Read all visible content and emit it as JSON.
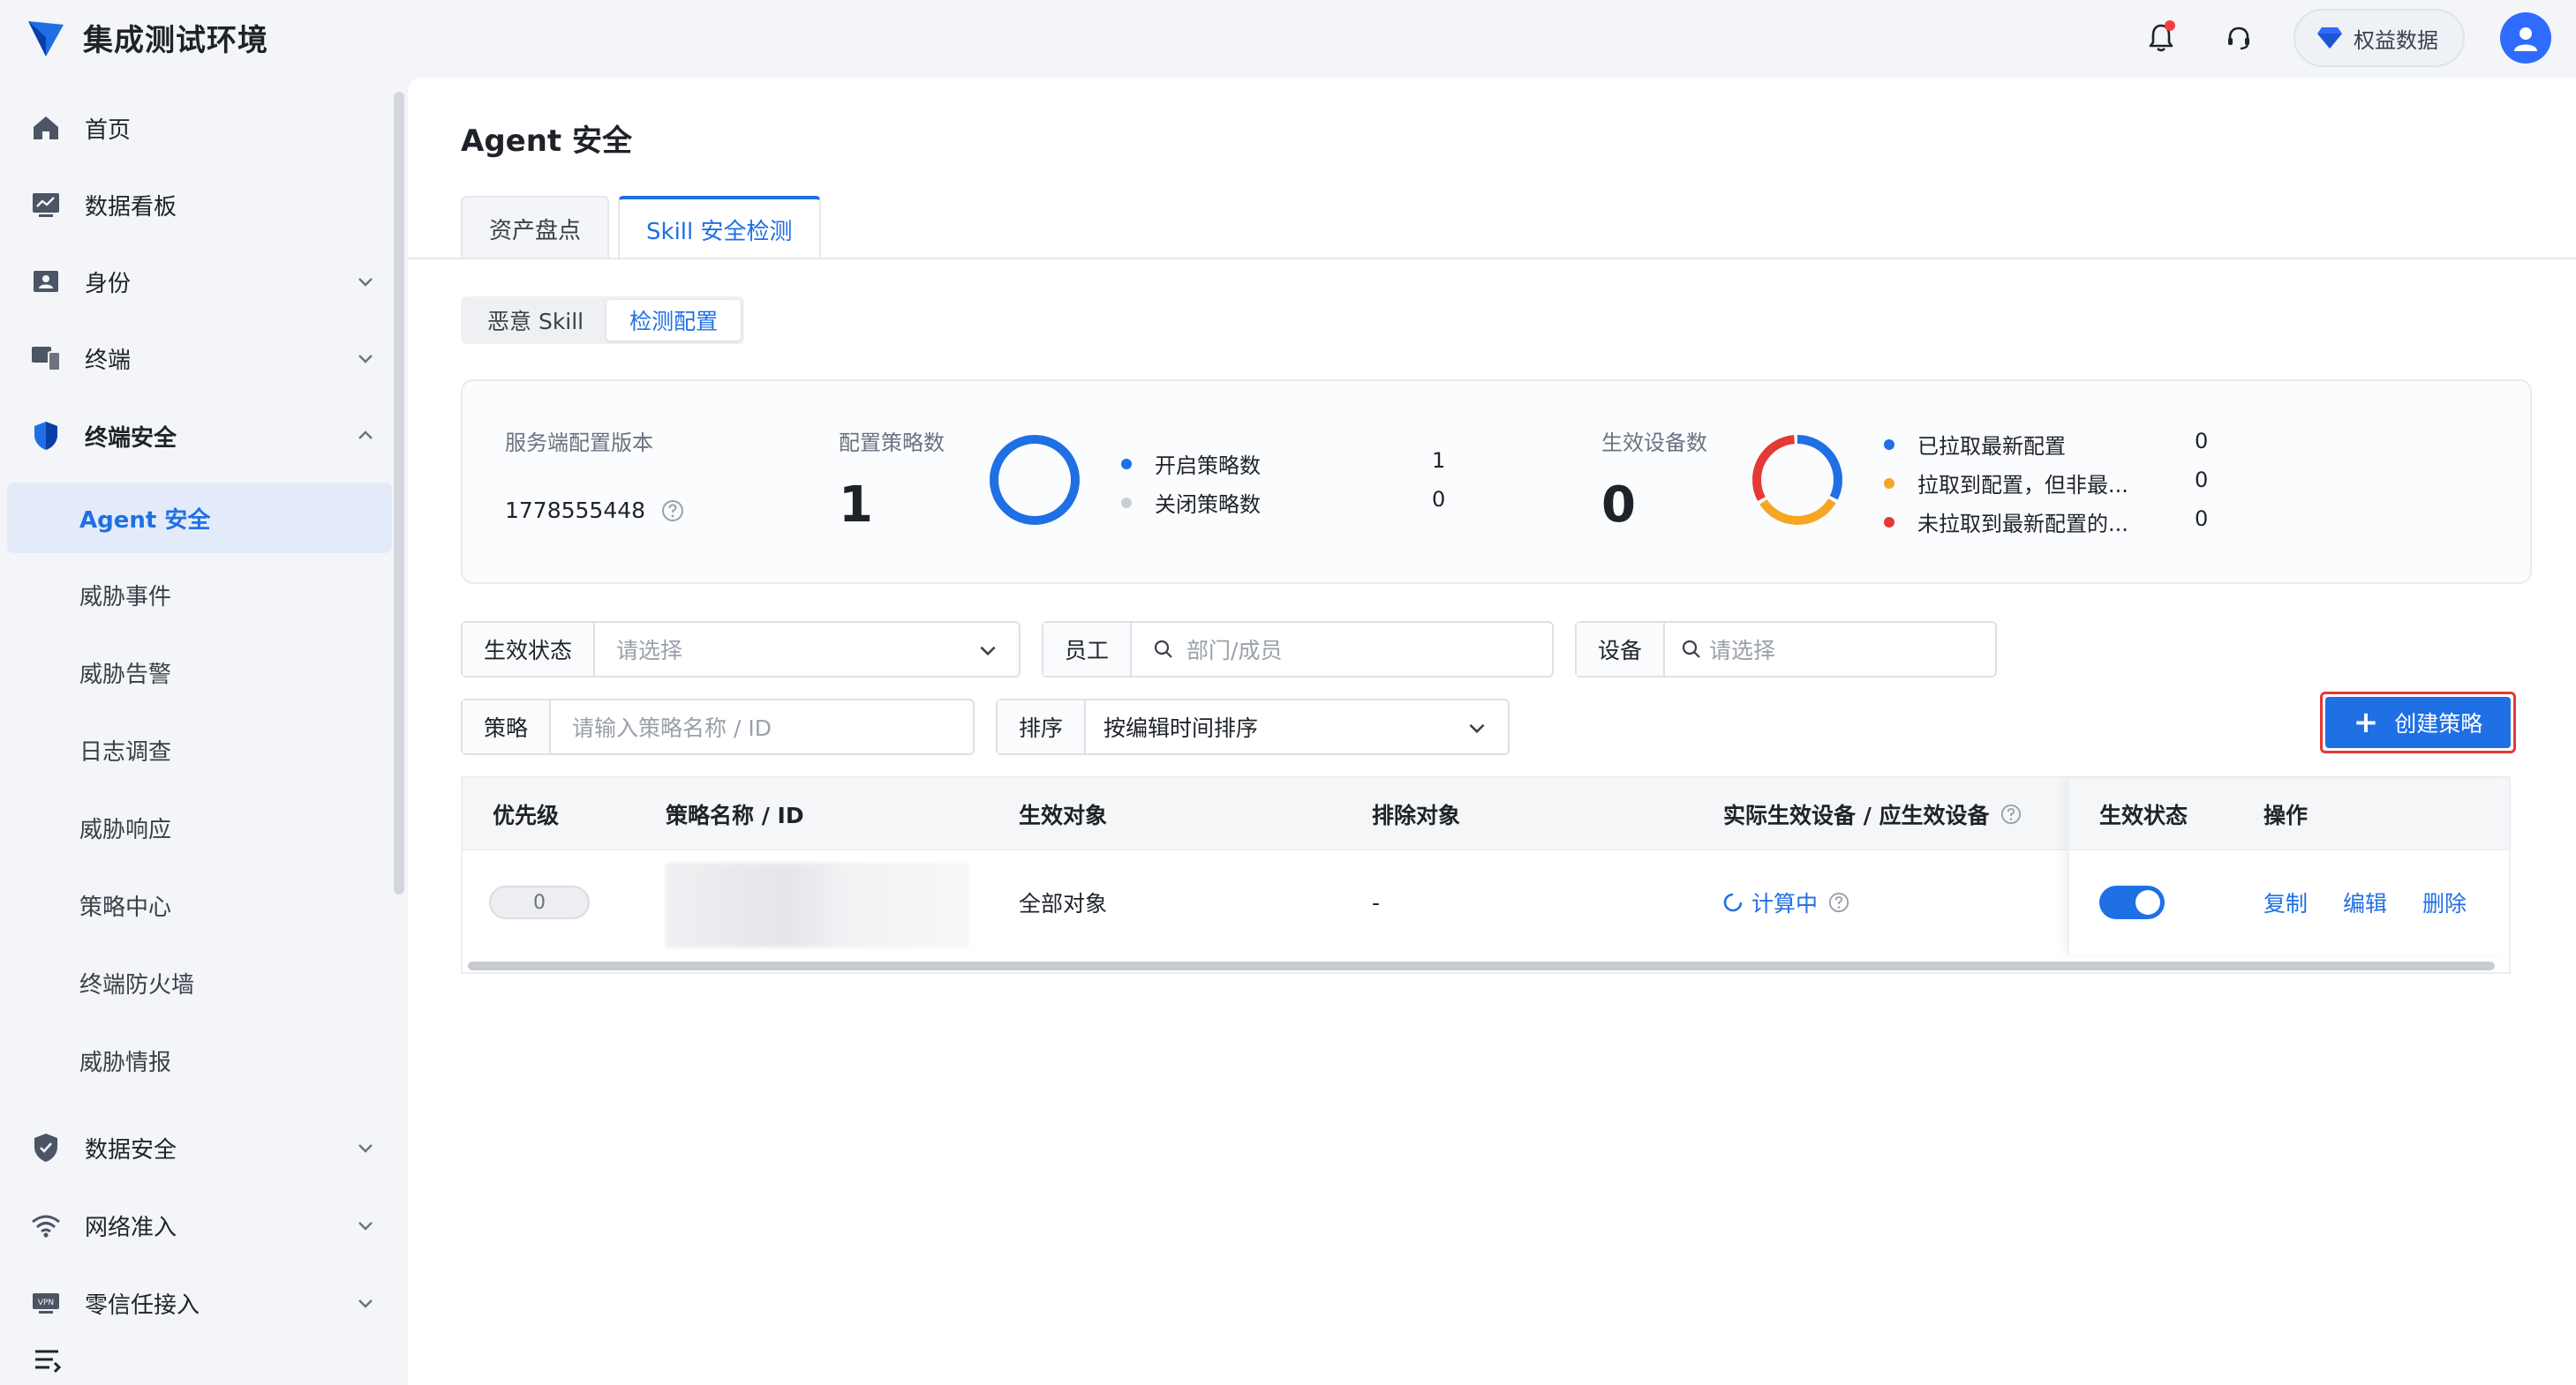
{
  "app": {
    "title": "集成测试环境"
  },
  "topbar": {
    "rights_label": "权益数据"
  },
  "sidebar": {
    "items": [
      {
        "label": "首页",
        "icon": "home-icon"
      },
      {
        "label": "数据看板",
        "icon": "dashboard-icon"
      },
      {
        "label": "身份",
        "icon": "id-card-icon"
      },
      {
        "label": "终端",
        "icon": "devices-icon"
      },
      {
        "label": "终端安全",
        "icon": "shield-icon"
      },
      {
        "label": "Agent 安全"
      },
      {
        "label": "威胁事件"
      },
      {
        "label": "威胁告警"
      },
      {
        "label": "日志调查"
      },
      {
        "label": "威胁响应"
      },
      {
        "label": "策略中心"
      },
      {
        "label": "终端防火墙"
      },
      {
        "label": "威胁情报"
      },
      {
        "label": "数据安全",
        "icon": "data-shield-icon"
      },
      {
        "label": "网络准入",
        "icon": "wifi-icon"
      },
      {
        "label": "零信任接入",
        "icon": "vpn-icon"
      }
    ]
  },
  "page": {
    "title": "Agent 安全"
  },
  "tabs": [
    {
      "label": "资产盘点"
    },
    {
      "label": "Skill 安全检测"
    }
  ],
  "segments": [
    {
      "label": "恶意 Skill"
    },
    {
      "label": "检测配置"
    }
  ],
  "stats": {
    "server_version_label": "服务端配置版本",
    "server_version": "1778555448",
    "policy_count_label": "配置策略数",
    "policy_count": "1",
    "policy_legend": [
      {
        "label": "开启策略数",
        "value": "1",
        "color": "#1f6fe5"
      },
      {
        "label": "关闭策略数",
        "value": "0",
        "color": "#c9cdd4"
      }
    ],
    "device_count_label": "生效设备数",
    "device_count": "0",
    "device_legend": [
      {
        "label": "已拉取最新配置",
        "value": "0",
        "color": "#1f6fe5"
      },
      {
        "label": "拉取到配置，但非最...",
        "value": "0",
        "color": "#f5a623"
      },
      {
        "label": "未拉取到最新配置的...",
        "value": "0",
        "color": "#e53935"
      }
    ]
  },
  "filters": {
    "status_label": "生效状态",
    "status_placeholder": "请选择",
    "employee_label": "员工",
    "employee_placeholder": "部门/成员",
    "device_label": "设备",
    "device_placeholder": "请选择",
    "policy_label": "策略",
    "policy_placeholder": "请输入策略名称 / ID",
    "sort_label": "排序",
    "sort_value": "按编辑时间排序"
  },
  "create_button": {
    "label": "创建策略"
  },
  "table": {
    "columns": [
      "优先级",
      "策略名称 / ID",
      "生效对象",
      "排除对象",
      "实际生效设备 / 应生效设备",
      "生效状态",
      "操作"
    ],
    "rows": [
      {
        "priority": "0",
        "target": "全部对象",
        "exclude": "-",
        "devices_status": "计算中",
        "enabled": true,
        "actions": [
          "复制",
          "编辑",
          "删除"
        ]
      }
    ]
  },
  "colors": {
    "accent": "#1f6fe5",
    "danger": "#e53935",
    "warning": "#f5a623"
  }
}
